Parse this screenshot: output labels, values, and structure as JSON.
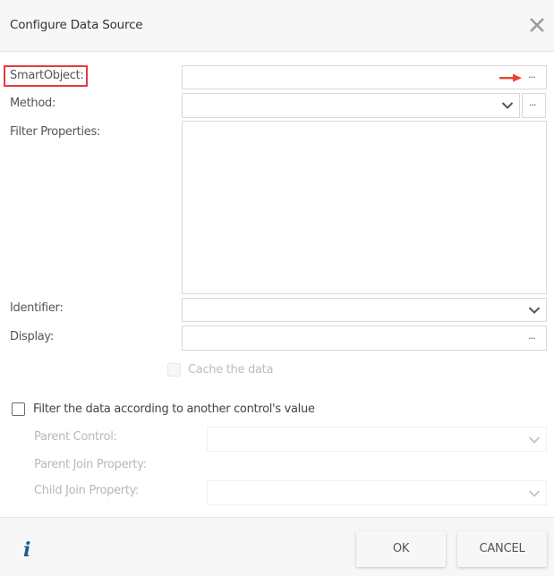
{
  "dialog": {
    "title": "Configure Data Source",
    "close_icon": "close-icon"
  },
  "form": {
    "smartobject": {
      "label": "SmartObject:",
      "value": "",
      "browse_label": "···",
      "annotation": "red-arrow-pointing-to-browse"
    },
    "method": {
      "label": "Method:",
      "value": "",
      "browse_label": "···"
    },
    "filter_properties": {
      "label": "Filter Properties:",
      "value": ""
    },
    "identifier": {
      "label": "Identifier:",
      "value": ""
    },
    "display": {
      "label": "Display:",
      "value": "",
      "browse_label": "···"
    },
    "cache": {
      "label": "Cache the data",
      "checked": false,
      "disabled": true
    }
  },
  "filter_section": {
    "checkbox_label": "Filter the data according to another control's value",
    "checked": false,
    "parent_control": {
      "label": "Parent Control:",
      "value": ""
    },
    "parent_join_property": {
      "label": "Parent Join Property:"
    },
    "child_join_property": {
      "label": "Child Join Property:",
      "value": ""
    }
  },
  "footer": {
    "info_icon": "i",
    "ok_label": "OK",
    "cancel_label": "CANCEL"
  },
  "colors": {
    "highlight": "#e8383d",
    "arrow": "#e8472a",
    "info": "#1f5f8b"
  }
}
